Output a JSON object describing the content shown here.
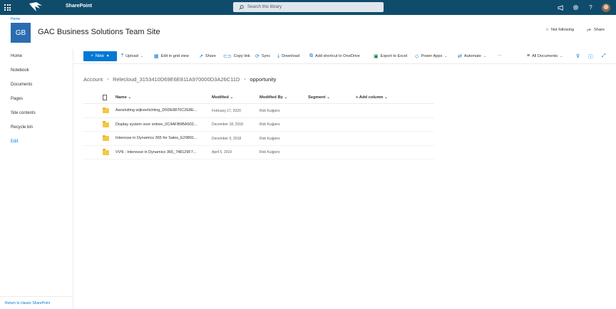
{
  "suite": {
    "brand": "SharePoint",
    "search_placeholder": "Search this library",
    "icons": [
      "waffle-icon",
      "megaphone-icon",
      "gear-icon",
      "help-icon",
      "avatar"
    ]
  },
  "site": {
    "home_crumb": "Home",
    "logo_initials": "GB",
    "title": "GAC Business Solutions Team Site",
    "follow_label": "Not following",
    "share_label": "Share"
  },
  "nav": {
    "items": [
      "Home",
      "Notebook",
      "Documents",
      "Pages",
      "Site contents",
      "Recycle bin"
    ],
    "edit": "Edit",
    "classic": "Return to classic SharePoint"
  },
  "commands": {
    "new": "New",
    "upload": "Upload",
    "edit_grid": "Edit in grid view",
    "share": "Share",
    "copy_link": "Copy link",
    "sync": "Sync",
    "download": "Download",
    "add_shortcut": "Add shortcut to OneDrive",
    "export_excel": "Export to Excel",
    "power_apps": "Power Apps",
    "automate": "Automate",
    "more": "···",
    "view": "All Documents"
  },
  "breadcrumb": [
    "Account",
    "Relecloud_3153410D69E6E811A970000D3A26C11D",
    "opportunity"
  ],
  "columns": {
    "name": "Name",
    "modified": "Modified",
    "modified_by": "Modified By",
    "segment": "Segment",
    "add_column": "Add column"
  },
  "rows": [
    {
      "name": "Aansluiting wijkverlichting_D5DE8870C2E8E...",
      "modified": "February 17, 2020",
      "by": "Rob Kuijpers"
    },
    {
      "name": "Display system voor entree_0C4AFB9BA502...",
      "modified": "December 18, 2018",
      "by": "Rob Kuijpers"
    },
    {
      "name": "Interesse in Dynamics 365 for Sales_E29891...",
      "modified": "December 5, 2018",
      "by": "Rob Kuijpers"
    },
    {
      "name": "VVN - Interesse in Dynamics 365_748129F7...",
      "modified": "April 5, 2019",
      "by": "Rob Kuijpers"
    }
  ]
}
